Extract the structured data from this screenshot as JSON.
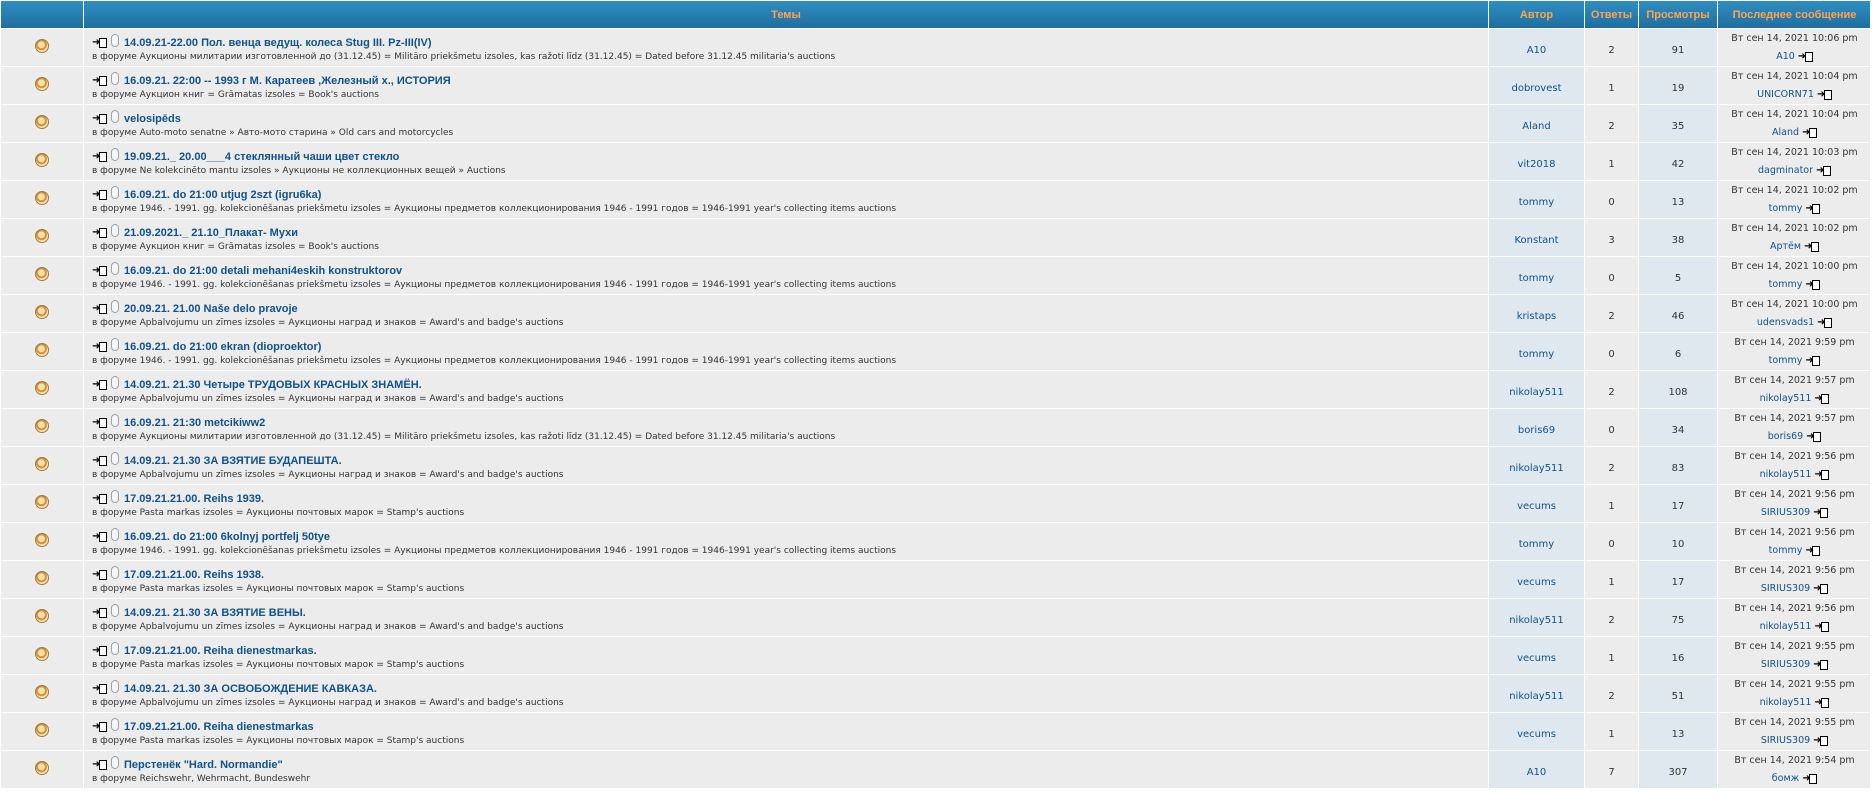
{
  "table": {
    "headers": {
      "topics": "Темы",
      "author": "Автор",
      "replies": "Ответы",
      "views": "Просмотры",
      "last_post": "Последнее сообщение"
    },
    "forum_prefix": "в форуме",
    "rows": [
      {
        "title": "14.09.21-22.00 Пол. венца ведущ. колеса Stug III. Pz-III(IV)",
        "forum": "Аукционы милитарии изготовленной до (31.12.45) = Militāro priekšmetu izsoles, kas ražoti līdz (31.12.45) = Dated before 31.12.45 militaria's auctions",
        "author": "A10",
        "replies": "2",
        "views": "91",
        "last_date": "Вт сен 14, 2021 10:06 pm",
        "last_user": "A10"
      },
      {
        "title": "16.09.21. 22:00 -- 1993 г М. Каратеев ,Железный х., ИСТОРИЯ",
        "forum": "Аукцион книг = Grāmatas izsoles = Book's auctions",
        "author": "dobrovest",
        "replies": "1",
        "views": "19",
        "last_date": "Вт сен 14, 2021 10:04 pm",
        "last_user": "UNICORN71"
      },
      {
        "title": "velosipēds",
        "forum": "Auto-moto senatne » Авто-мото старина » Old cars and motorcycles",
        "author": "Aland",
        "replies": "2",
        "views": "35",
        "last_date": "Вт сен 14, 2021 10:04 pm",
        "last_user": "Aland"
      },
      {
        "title": "19.09.21._ 20.00___4 стеклянный чаши цвет стекло",
        "forum": "Ne kolekcinēto mantu izsoles » Аукционы не коллекционных вещей » Auctions",
        "author": "vit2018",
        "replies": "1",
        "views": "42",
        "last_date": "Вт сен 14, 2021 10:03 pm",
        "last_user": "dagminator"
      },
      {
        "title": "16.09.21. do 21:00 utjug 2szt (igru6ka)",
        "forum": "1946. - 1991. gg. kolekcionēšanas priekšmetu izsoles = Аукционы предметов коллекционирования 1946 - 1991 годов = 1946-1991 year's collecting items auctions",
        "author": "tommy",
        "replies": "0",
        "views": "13",
        "last_date": "Вт сен 14, 2021 10:02 pm",
        "last_user": "tommy"
      },
      {
        "title": "21.09.2021._ 21.10_Плакат- Мухи",
        "forum": "Аукцион книг = Grāmatas izsoles = Book's auctions",
        "author": "Konstant",
        "replies": "3",
        "views": "38",
        "last_date": "Вт сен 14, 2021 10:02 pm",
        "last_user": "Артём"
      },
      {
        "title": "16.09.21. do 21:00 detali mehani4eskih konstruktorov",
        "forum": "1946. - 1991. gg. kolekcionēšanas priekšmetu izsoles = Аукционы предметов коллекционирования 1946 - 1991 годов = 1946-1991 year's collecting items auctions",
        "author": "tommy",
        "replies": "0",
        "views": "5",
        "last_date": "Вт сен 14, 2021 10:00 pm",
        "last_user": "tommy"
      },
      {
        "title": "20.09.21. 21.00 Naše delo pravoje",
        "forum": "Apbalvojumu un zīmes izsoles = Аукционы наград и знаков = Award's and badge's auctions",
        "author": "kristaps",
        "replies": "2",
        "views": "46",
        "last_date": "Вт сен 14, 2021 10:00 pm",
        "last_user": "udensvads1"
      },
      {
        "title": "16.09.21. do 21:00 ekran (dioproektor)",
        "forum": "1946. - 1991. gg. kolekcionēšanas priekšmetu izsoles = Аукционы предметов коллекционирования 1946 - 1991 годов = 1946-1991 year's collecting items auctions",
        "author": "tommy",
        "replies": "0",
        "views": "6",
        "last_date": "Вт сен 14, 2021 9:59 pm",
        "last_user": "tommy"
      },
      {
        "title": "14.09.21. 21.30 Четыре ТРУДОВЫХ КРАСНЫХ ЗНАМЁН.",
        "forum": "Apbalvojumu un zīmes izsoles = Аукционы наград и знаков = Award's and badge's auctions",
        "author": "nikolay511",
        "replies": "2",
        "views": "108",
        "last_date": "Вт сен 14, 2021 9:57 pm",
        "last_user": "nikolay511"
      },
      {
        "title": "16.09.21. 21:30 metcikiww2",
        "forum": "Аукционы милитарии изготовленной до (31.12.45) = Militāro priekšmetu izsoles, kas ražoti līdz (31.12.45) = Dated before 31.12.45 militaria's auctions",
        "author": "boris69",
        "replies": "0",
        "views": "34",
        "last_date": "Вт сен 14, 2021 9:57 pm",
        "last_user": "boris69"
      },
      {
        "title": "14.09.21. 21.30 ЗА ВЗЯТИЕ БУДАПЕШТА.",
        "forum": "Apbalvojumu un zīmes izsoles = Аукционы наград и знаков = Award's and badge's auctions",
        "author": "nikolay511",
        "replies": "2",
        "views": "83",
        "last_date": "Вт сен 14, 2021 9:56 pm",
        "last_user": "nikolay511"
      },
      {
        "title": "17.09.21.21.00. Reihs 1939.",
        "forum": "Pasta markas izsoles = Аукционы почтовых марок = Stamp's auctions",
        "author": "vecums",
        "replies": "1",
        "views": "17",
        "last_date": "Вт сен 14, 2021 9:56 pm",
        "last_user": "SIRIUS309"
      },
      {
        "title": "16.09.21. do 21:00 6kolnyj portfelj 50tye",
        "forum": "1946. - 1991. gg. kolekcionēšanas priekšmetu izsoles = Аукционы предметов коллекционирования 1946 - 1991 годов = 1946-1991 year's collecting items auctions",
        "author": "tommy",
        "replies": "0",
        "views": "10",
        "last_date": "Вт сен 14, 2021 9:56 pm",
        "last_user": "tommy"
      },
      {
        "title": "17.09.21.21.00. Reihs 1938.",
        "forum": "Pasta markas izsoles = Аукционы почтовых марок = Stamp's auctions",
        "author": "vecums",
        "replies": "1",
        "views": "17",
        "last_date": "Вт сен 14, 2021 9:56 pm",
        "last_user": "SIRIUS309"
      },
      {
        "title": "14.09.21. 21.30 ЗА ВЗЯТИЕ ВЕНЫ.",
        "forum": "Apbalvojumu un zīmes izsoles = Аукционы наград и знаков = Award's and badge's auctions",
        "author": "nikolay511",
        "replies": "2",
        "views": "75",
        "last_date": "Вт сен 14, 2021 9:56 pm",
        "last_user": "nikolay511"
      },
      {
        "title": "17.09.21.21.00. Reiha dienestmarkas.",
        "forum": "Pasta markas izsoles = Аукционы почтовых марок = Stamp's auctions",
        "author": "vecums",
        "replies": "1",
        "views": "16",
        "last_date": "Вт сен 14, 2021 9:55 pm",
        "last_user": "SIRIUS309"
      },
      {
        "title": "14.09.21. 21.30 ЗА ОСВОБОЖДЕНИЕ КАВКАЗА.",
        "forum": "Apbalvojumu un zīmes izsoles = Аукционы наград и знаков = Award's and badge's auctions",
        "author": "nikolay511",
        "replies": "2",
        "views": "51",
        "last_date": "Вт сен 14, 2021 9:55 pm",
        "last_user": "nikolay511"
      },
      {
        "title": "17.09.21.21.00. Reiha dienestmarkas",
        "forum": "Pasta markas izsoles = Аукционы почтовых марок = Stamp's auctions",
        "author": "vecums",
        "replies": "1",
        "views": "13",
        "last_date": "Вт сен 14, 2021 9:55 pm",
        "last_user": "SIRIUS309"
      },
      {
        "title": "Перстенёк \"Hard. Normandie\"",
        "forum": "Reichswehr, Wehrmacht, Bundeswehr",
        "author": "A10",
        "replies": "7",
        "views": "307",
        "last_date": "Вт сен 14, 2021 9:54 pm",
        "last_user": "бомж"
      }
    ]
  }
}
